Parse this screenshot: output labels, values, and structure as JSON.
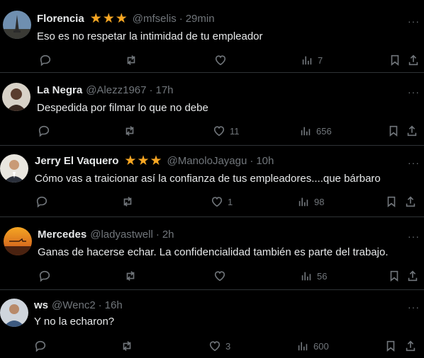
{
  "more_label": "···",
  "colors": {
    "background": "#000000",
    "text": "#e7e9ea",
    "muted": "#71767b",
    "star": "#f6a623",
    "divider": "#2f3336"
  },
  "replies": [
    {
      "name": "Florencia",
      "stars": "★★★",
      "handle": "@mfselis",
      "dot": "·",
      "time": "29min",
      "text": "Eso es no respetar la intimidad de tu empleador",
      "replies_count": "",
      "reposts": "",
      "likes": "",
      "views": "7",
      "avatar_icon": "avatar-eiffel-tower-icon"
    },
    {
      "name": "La Negra",
      "stars": "",
      "handle": "@Alezz1967",
      "dot": "·",
      "time": "17h",
      "text": "Despedida por filmar lo que no debe",
      "replies_count": "",
      "reposts": "",
      "likes": "11",
      "views": "656",
      "avatar_icon": "avatar-portrait-icon"
    },
    {
      "name": "Jerry El Vaquero",
      "stars": "★★★",
      "handle": "@ManoloJayagu",
      "dot": "·",
      "time": "10h",
      "text": "Cómo vas a traicionar así la confianza de tus empleadores....que bárbaro",
      "replies_count": "",
      "reposts": "",
      "likes": "1",
      "views": "98",
      "avatar_icon": "avatar-man-suit-icon"
    },
    {
      "name": "Mercedes",
      "stars": "",
      "handle": "@ladyastwell",
      "dot": "·",
      "time": "2h",
      "text": "Ganas de hacerse echar. La confidencialidad también es parte del trabajo.",
      "replies_count": "",
      "reposts": "",
      "likes": "",
      "views": "56",
      "avatar_icon": "avatar-sunset-plane-icon"
    },
    {
      "name": "ws",
      "stars": "",
      "handle": "@Wenc2",
      "dot": "·",
      "time": "16h",
      "text": "Y no la echaron?",
      "replies_count": "",
      "reposts": "",
      "likes": "3",
      "views": "600",
      "avatar_icon": "avatar-man-icon"
    }
  ]
}
